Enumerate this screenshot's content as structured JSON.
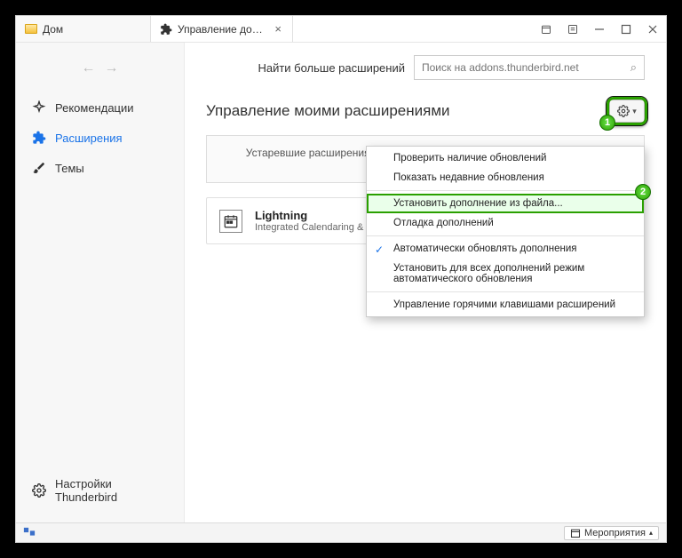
{
  "tabs": {
    "home": "Дом",
    "addons": "Управление дополнениями"
  },
  "search": {
    "label": "Найти больше расширений",
    "placeholder": "Поиск на addons.thunderbird.net"
  },
  "sidebar": {
    "recommendations": "Рекомендации",
    "extensions": "Расширения",
    "themes": "Темы",
    "settings": "Настройки Thunderbird"
  },
  "heading": "Управление моими расширениями",
  "banner": "Устаревшие расширения должны быть обновлены для совместимости с Thunderbird.",
  "addon": {
    "name": "Lightning",
    "desc": "Integrated Calendaring & Scheduling"
  },
  "menu": {
    "check_updates": "Проверить наличие обновлений",
    "recent_updates": "Показать недавние обновления",
    "install_from_file": "Установить дополнение из файла...",
    "debug": "Отладка дополнений",
    "auto_update": "Автоматически обновлять дополнения",
    "set_all_auto": "Установить для всех дополнений режим автоматического обновления",
    "manage_shortcuts": "Управление горячими клавишами расширений"
  },
  "badges": {
    "one": "1",
    "two": "2"
  },
  "statusbar": {
    "events": "Мероприятия"
  }
}
